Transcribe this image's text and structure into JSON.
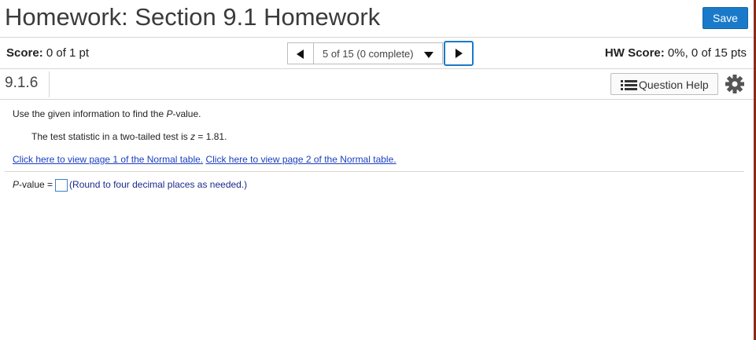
{
  "header": {
    "title": "Homework: Section 9.1 Homework",
    "save_label": "Save"
  },
  "score_bar": {
    "score_label": "Score:",
    "score_value": "0 of 1 pt",
    "nav_position": "5 of 15 (0 complete)",
    "hw_score_label": "HW Score:",
    "hw_score_value": "0%, 0 of 15 pts"
  },
  "question_bar": {
    "number": "9.1.6",
    "help_label": "Question Help"
  },
  "question": {
    "instruction_pre": "Use the given information to find the ",
    "instruction_var": "P",
    "instruction_post": "-value.",
    "statement_pre": "The test statistic in a two-tailed test is ",
    "statement_var": "z",
    "statement_post": " = 1.81.",
    "link1": "Click here to view page 1 of the Normal table.",
    "link2": "Click here to view page 2 of the Normal table."
  },
  "answer": {
    "label_var": "P",
    "label_post": "-value =",
    "value": "",
    "hint": "(Round to four decimal places as needed.)"
  },
  "colors": {
    "save_button": "#1a7ac9",
    "link": "#1a3ebf",
    "hint": "#1c2a8c",
    "right_rule": "#8b2a1a"
  },
  "icons": [
    "triangle-left-icon",
    "triangle-down-icon",
    "triangle-right-icon",
    "list-icon",
    "gear-icon"
  ]
}
